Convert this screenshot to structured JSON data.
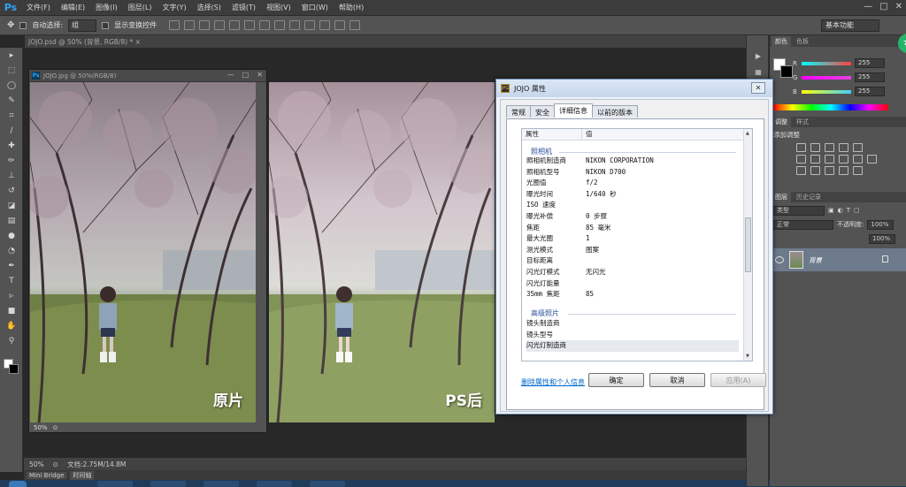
{
  "app": {
    "logo": "Ps"
  },
  "menu": [
    "文件(F)",
    "编辑(E)",
    "图像(I)",
    "图层(L)",
    "文字(Y)",
    "选择(S)",
    "滤镜(T)",
    "视图(V)",
    "窗口(W)",
    "帮助(H)"
  ],
  "window_controls": [
    "—",
    "□",
    "✕"
  ],
  "options_bar": {
    "auto_select_label": "自动选择:",
    "auto_select_value": "组",
    "show_transform_label": "显示变换控件",
    "workspace": "基本功能"
  },
  "doc_tab": {
    "title": "JOJO.psd @ 50% (背景, RGB/8) *  ×"
  },
  "doc_window": {
    "title": "JOJO.jpg @ 50%(RGB/8)",
    "zoom": "50%"
  },
  "photos": {
    "before_label": "原片",
    "after_label": "PS后"
  },
  "status": {
    "zoom": "50%",
    "doc_size": "文档:2.75M/14.8M"
  },
  "bridge": {
    "tab1": "Mini Bridge",
    "tab2": "时间轴"
  },
  "color_panel": {
    "tabs": [
      "颜色",
      "色板"
    ],
    "channels": [
      {
        "name": "R",
        "value": "255",
        "color": "#ff4040"
      },
      {
        "name": "G",
        "value": "255",
        "color": "#e040e0"
      },
      {
        "name": "B",
        "value": "255",
        "color": "#40d0ff"
      }
    ]
  },
  "adjust_panel": {
    "tabs": [
      "调整",
      "样式"
    ],
    "title": "添加调整"
  },
  "layers_panel": {
    "tabs": [
      "图层",
      "历史记录"
    ],
    "kind": "类型",
    "blend": "正常",
    "opacity_label": "不透明度:",
    "opacity": "100%",
    "fill": "100%",
    "layer_name": "背景"
  },
  "badge": "71",
  "dialog": {
    "title": "JOJO 属性",
    "tabs": [
      "常规",
      "安全",
      "详细信息",
      "以前的版本"
    ],
    "col_property": "属性",
    "col_value": "值",
    "group_camera": "照相机",
    "group_advanced": "高级照片",
    "camera_rows": [
      {
        "k": "照相机制造商",
        "v": "NIKON CORPORATION"
      },
      {
        "k": "照相机型号",
        "v": "NIKON D700"
      },
      {
        "k": "光圈值",
        "v": "f/2"
      },
      {
        "k": "曝光时间",
        "v": "1/640 秒"
      },
      {
        "k": "ISO 速度",
        "v": ""
      },
      {
        "k": "曝光补偿",
        "v": "0 步骤"
      },
      {
        "k": "焦距",
        "v": "85 毫米"
      },
      {
        "k": "最大光圈",
        "v": "1"
      },
      {
        "k": "测光模式",
        "v": "图案"
      },
      {
        "k": "目标距离",
        "v": ""
      },
      {
        "k": "闪光灯模式",
        "v": "无闪光"
      },
      {
        "k": "闪光灯能量",
        "v": ""
      },
      {
        "k": "35mm 焦距",
        "v": "85"
      }
    ],
    "advanced_rows": [
      {
        "k": "镜头制造商",
        "v": ""
      },
      {
        "k": "镜头型号",
        "v": ""
      },
      {
        "k": "闪光灯制造商",
        "v": ""
      }
    ],
    "remove_link": "删除属性和个人信息",
    "ok": "确定",
    "cancel": "取消",
    "apply": "应用(A)"
  }
}
